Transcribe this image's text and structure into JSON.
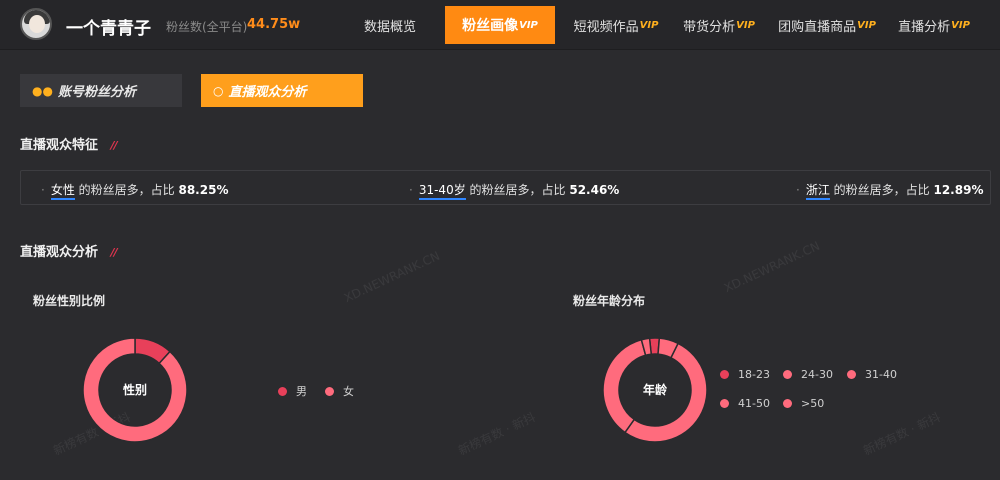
{
  "header": {
    "nickname": "一个青青子",
    "fans_label": "粉丝数(全平台)",
    "fans_value": "44.75w",
    "nav": [
      {
        "label": "数据概览",
        "vip": ""
      },
      {
        "label": "粉丝画像",
        "vip": "VIP"
      },
      {
        "label": "短视频作品",
        "vip": "VIP"
      },
      {
        "label": "带货分析",
        "vip": "VIP"
      },
      {
        "label": "团购直播商品",
        "vip": "VIP"
      },
      {
        "label": "直播分析",
        "vip": "VIP"
      }
    ]
  },
  "subtabs": {
    "fans_analysis": "账号粉丝分析",
    "live_audience": "直播观众分析"
  },
  "features": {
    "title": "直播观众特征",
    "items": [
      {
        "highlight": "女性",
        "text": " 的粉丝居多，占比 ",
        "pct": "88.25%"
      },
      {
        "highlight": "31-40岁",
        "text": " 的粉丝居多，占比 ",
        "pct": "52.46%"
      },
      {
        "highlight": "浙江",
        "text": " 的粉丝居多，占比 ",
        "pct": "12.89%"
      }
    ]
  },
  "analysis": {
    "title": "直播观众分析"
  },
  "gender_chart": {
    "title": "粉丝性别比例",
    "center": "性别",
    "legend": [
      {
        "label": "男",
        "color": "#e8405a"
      },
      {
        "label": "女",
        "color": "#ff6b7d"
      }
    ]
  },
  "age_chart": {
    "title": "粉丝年龄分布",
    "center": "年龄",
    "legend": [
      {
        "label": "18-23",
        "color": "#e8405a"
      },
      {
        "label": "24-30",
        "color": "#ff6b7d"
      },
      {
        "label": "31-40",
        "color": "#ff6b7d"
      },
      {
        "label": "41-50",
        "color": "#ff6b7d"
      },
      {
        "label": ">50",
        "color": "#ff6b7d"
      }
    ]
  },
  "chart_data": [
    {
      "type": "pie",
      "title": "粉丝性别比例",
      "categories": [
        "男",
        "女"
      ],
      "values": [
        11.75,
        88.25
      ]
    },
    {
      "type": "pie",
      "title": "粉丝年龄分布",
      "categories": [
        "18-23",
        "24-30",
        "31-40",
        "41-50",
        ">50"
      ],
      "values": [
        3,
        6,
        52.46,
        36,
        2.54
      ]
    }
  ],
  "watermark": "XD.NEWRANK.CN",
  "watermark2": "新榜有数 · 新抖",
  "colors": {
    "accent": "#ff8a12",
    "chart_primary": "#ff6b7d",
    "chart_dark": "#e8405a",
    "highlight_underline": "#2f86ff"
  }
}
